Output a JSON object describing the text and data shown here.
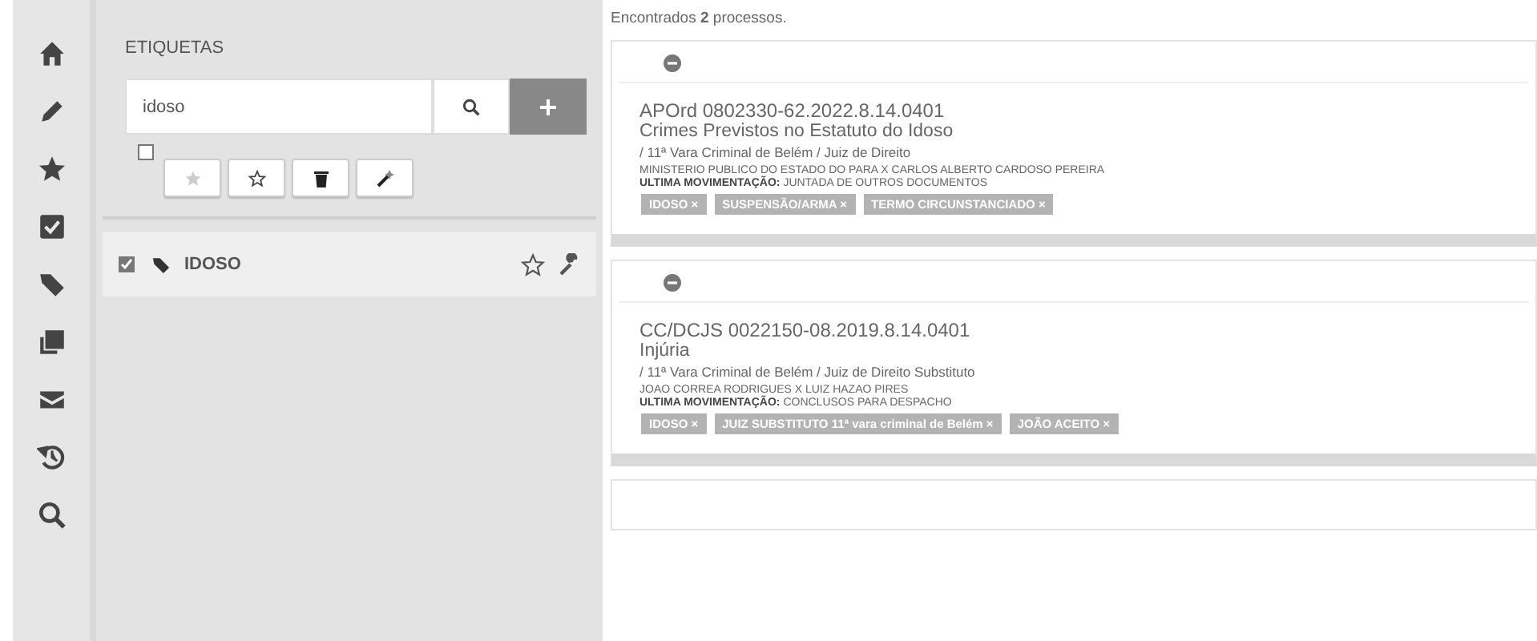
{
  "tag_panel": {
    "title": "ETIQUETAS",
    "search": {
      "value": "idoso"
    },
    "select_all": {
      "checked": false
    },
    "tags": [
      {
        "label": "IDOSO",
        "checked": true
      }
    ]
  },
  "results": {
    "summary": "Encontrados **2** processos.",
    "processes": [
      {
        "number": "APOrd 0802330-62.2022.8.14.0401",
        "subject": "Crimes Previstos no Estatuto do Idoso",
        "court": "/ 11ª Vara Criminal de Belém / Juiz de Direito",
        "parties": "MINISTERIO PUBLICO DO ESTADO DO PARA X CARLOS ALBERTO CARDOSO PEREIRA",
        "last_movement": "**ULTIMA MOVIMENTAÇÃO:** JUNTADA DE OUTROS DOCUMENTOS",
        "tags": [
          "IDOSO ×",
          "SUSPENSÃO/ARMA ×",
          "TERMO CIRCUNSTANCIADO ×"
        ]
      },
      {
        "number": "CC/DCJS 0022150-08.2019.8.14.0401",
        "subject": "Injúria",
        "court": "/ 11ª Vara Criminal de Belém / Juiz de Direito Substituto",
        "parties": "JOAO CORREA RODRIGUES X LUIZ HAZAO PIRES",
        "last_movement": "**ULTIMA MOVIMENTAÇÃO:** CONCLUSOS PARA DESPACHO",
        "tags": [
          "IDOSO ×",
          "JUIZ SUBSTITUTO 11ª vara criminal de Belém ×",
          "JOÃO ACEITO ×"
        ]
      }
    ]
  }
}
